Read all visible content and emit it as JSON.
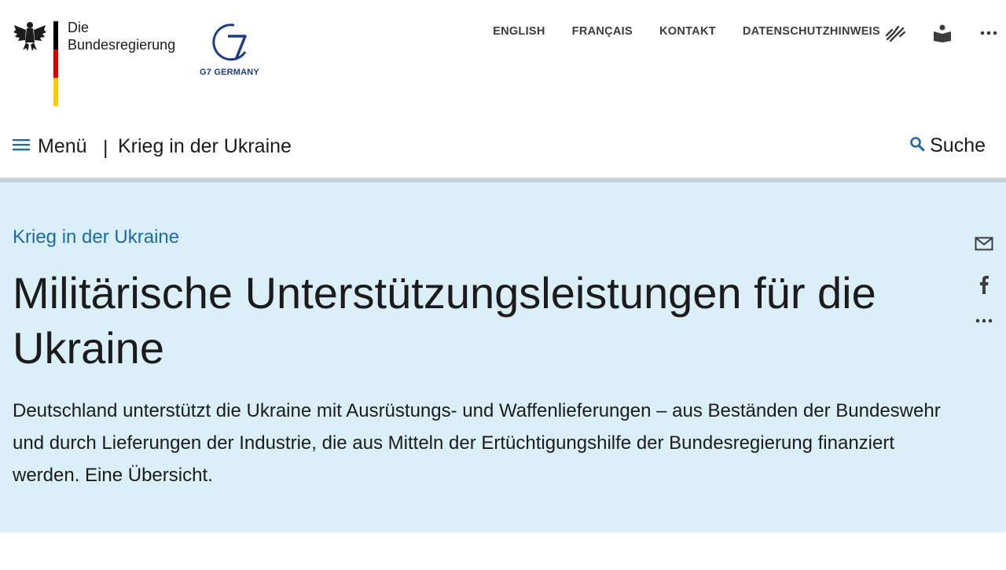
{
  "header": {
    "brand_line1": "Die",
    "brand_line2": "Bundesregierung",
    "g7_caption": "G7 GERMANY",
    "flag_colors": [
      "#000000",
      "#dd0000",
      "#ffcc00"
    ],
    "meta_nav": [
      "ENGLISH",
      "FRANÇAIS",
      "KONTAKT",
      "DATENSCHUTZHINWEIS"
    ],
    "meta_icons": [
      "sign-language-icon",
      "easy-language-icon",
      "more-icon"
    ]
  },
  "mainbar": {
    "menu_label": "Menü",
    "divider": "|",
    "section_title": "Krieg in der Ukraine",
    "search_label": "Suche"
  },
  "hero": {
    "kicker": "Krieg in der Ukraine",
    "headline": "Militärische Unterstützungsleistungen für die Ukraine",
    "lead": "Deutschland unterstützt die Ukraine mit Ausrüstungs- und Waffenlieferungen – aus Beständen der Bundeswehr und durch Lieferungen der Industrie, die aus Mitteln der Ertüchtigungshilfe der Bundesregierung finanziert werden. Eine Übersicht.",
    "background": "#dbeff8",
    "share_icons": [
      "mail-icon",
      "facebook-icon",
      "more-icon"
    ]
  },
  "colors": {
    "accent": "#1e6aa6",
    "g7_blue": "#1d3d86"
  }
}
